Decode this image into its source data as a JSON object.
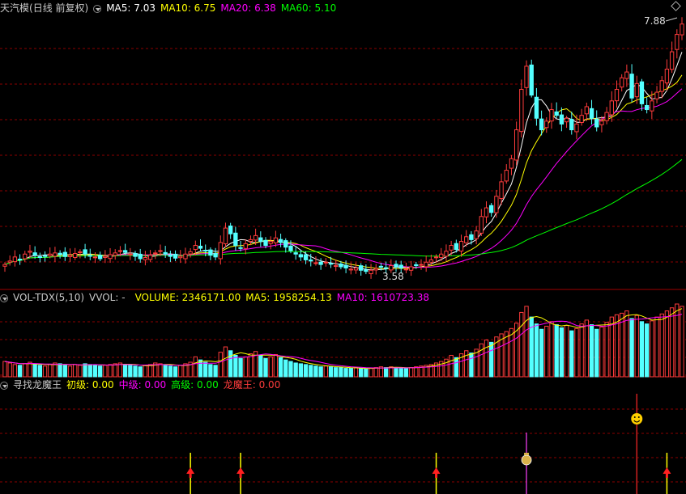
{
  "main": {
    "stock": "天汽模",
    "mode": "(日线 前复权)",
    "ma5": "MA5: 7.03",
    "ma10": "MA10: 6.75",
    "ma20": "MA20: 6.38",
    "ma60": "MA60: 5.10",
    "high_label": "7.88",
    "low_label": "3.58"
  },
  "vol": {
    "name": "VOL-TDX(5,10)",
    "vvol": "VVOL: -",
    "volume": "VOLUME: 2346171.00",
    "ma5": "MA5: 1958254.13",
    "ma10": "MA10: 1610723.38"
  },
  "ind": {
    "name": "寻找龙魔王",
    "chuji": "初级: 0.00",
    "zhongji": "中级: 0.00",
    "gaoji": "高级: 0.00",
    "longmowang": "龙魔王: 0.00"
  },
  "colors": {
    "up": "#ff3c3c",
    "down": "#54ffff",
    "ma5": "#ffffff",
    "ma10": "#ffff00",
    "ma20": "#ff00ff",
    "ma60": "#00ff00",
    "grid": "#8b0000"
  },
  "chart_data": {
    "type": "candlestick",
    "price_range": [
      3.4,
      8.1
    ],
    "close": [
      3.72,
      3.78,
      3.85,
      3.8,
      3.9,
      3.95,
      3.88,
      3.84,
      3.86,
      3.9,
      3.92,
      3.89,
      3.86,
      3.88,
      3.91,
      3.94,
      3.9,
      3.87,
      3.85,
      3.82,
      3.86,
      3.89,
      3.92,
      3.96,
      3.93,
      3.9,
      3.86,
      3.82,
      3.84,
      3.88,
      3.92,
      3.96,
      3.9,
      3.86,
      3.83,
      3.86,
      3.9,
      3.94,
      4.05,
      4.0,
      3.95,
      3.88,
      3.85,
      4.1,
      4.35,
      4.25,
      4.05,
      4.0,
      4.08,
      4.15,
      4.22,
      4.12,
      4.05,
      4.12,
      4.18,
      4.1,
      4.02,
      3.96,
      3.9,
      3.85,
      3.8,
      3.78,
      3.75,
      3.72,
      3.76,
      3.73,
      3.7,
      3.68,
      3.66,
      3.64,
      3.66,
      3.62,
      3.6,
      3.62,
      3.65,
      3.68,
      3.66,
      3.7,
      3.68,
      3.66,
      3.64,
      3.68,
      3.7,
      3.72,
      3.76,
      3.8,
      3.85,
      3.9,
      3.95,
      4.05,
      3.98,
      4.12,
      4.2,
      4.15,
      4.3,
      4.55,
      4.7,
      4.62,
      4.9,
      5.15,
      5.35,
      5.55,
      6.05,
      6.75,
      7.15,
      6.65,
      6.25,
      6.05,
      6.2,
      6.4,
      6.3,
      6.15,
      6.25,
      6.05,
      6.15,
      6.3,
      6.45,
      6.25,
      6.1,
      6.2,
      6.35,
      6.55,
      6.75,
      6.95,
      7.05,
      6.6,
      6.85,
      6.5,
      6.4,
      6.55,
      6.7,
      6.9,
      7.1,
      7.4,
      7.7,
      7.88
    ],
    "open_offset_note": "",
    "volume": [
      2.0,
      1.8,
      1.6,
      1.5,
      1.7,
      1.9,
      1.6,
      1.5,
      1.4,
      1.6,
      1.8,
      1.7,
      1.5,
      1.4,
      1.6,
      1.5,
      1.7,
      1.6,
      1.5,
      1.4,
      1.5,
      1.6,
      1.7,
      1.8,
      1.6,
      1.5,
      1.4,
      1.3,
      1.5,
      1.6,
      1.8,
      1.7,
      1.5,
      1.4,
      1.3,
      1.5,
      1.7,
      1.9,
      2.6,
      2.2,
      1.9,
      1.6,
      1.5,
      3.2,
      3.9,
      3.4,
      2.8,
      2.4,
      2.6,
      3.0,
      3.3,
      2.8,
      2.4,
      2.6,
      2.9,
      2.5,
      2.2,
      2.0,
      1.8,
      1.7,
      1.6,
      1.5,
      1.4,
      1.3,
      1.4,
      1.3,
      1.2,
      1.2,
      1.1,
      1.1,
      1.2,
      1.1,
      1.0,
      1.1,
      1.2,
      1.3,
      1.2,
      1.3,
      1.2,
      1.1,
      1.1,
      1.2,
      1.3,
      1.4,
      1.5,
      1.6,
      1.8,
      2.0,
      2.3,
      2.8,
      2.5,
      3.0,
      3.4,
      3.1,
      3.6,
      4.3,
      4.8,
      4.5,
      5.2,
      5.6,
      5.9,
      6.3,
      7.0,
      8.4,
      9.2,
      7.8,
      6.9,
      6.2,
      6.6,
      7.2,
      6.8,
      6.4,
      6.7,
      6.0,
      6.3,
      6.9,
      7.4,
      6.8,
      6.2,
      6.5,
      7.1,
      7.8,
      8.1,
      8.3,
      8.6,
      7.6,
      8.0,
      7.2,
      6.9,
      7.3,
      7.8,
      8.2,
      8.6,
      9.0,
      9.5,
      9.2
    ],
    "signals": [
      {
        "type": "arrow",
        "index": 37
      },
      {
        "type": "arrow",
        "index": 47
      },
      {
        "type": "arrow",
        "index": 86
      },
      {
        "type": "money",
        "index": 104
      },
      {
        "type": "smile",
        "index": 126
      },
      {
        "type": "arrow",
        "index": 132
      }
    ]
  }
}
